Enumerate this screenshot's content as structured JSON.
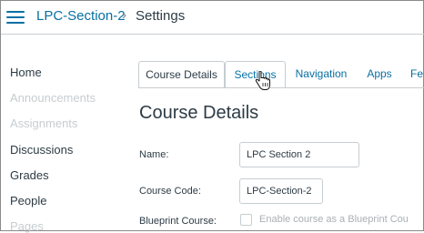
{
  "breadcrumb": {
    "course": "LPC-Section-2",
    "separator": "›",
    "current": "Settings"
  },
  "sidebar": {
    "items": [
      {
        "label": "Home",
        "enabled": true
      },
      {
        "label": "Announcements",
        "enabled": false
      },
      {
        "label": "Assignments",
        "enabled": false
      },
      {
        "label": "Discussions",
        "enabled": true
      },
      {
        "label": "Grades",
        "enabled": true
      },
      {
        "label": "People",
        "enabled": true
      },
      {
        "label": "Pages",
        "enabled": false
      }
    ]
  },
  "tabs": [
    {
      "label": "Course Details",
      "active": true
    },
    {
      "label": "Sections",
      "active": false
    },
    {
      "label": "Navigation",
      "active": false
    },
    {
      "label": "Apps",
      "active": false
    },
    {
      "label": "Fe",
      "active": false
    }
  ],
  "main": {
    "title": "Course Details",
    "name_label": "Name:",
    "name_value": "LPC Section 2",
    "code_label": "Course Code:",
    "code_value": "LPC-Section-2",
    "blueprint_label": "Blueprint Course:",
    "blueprint_checkbox_label": "Enable course as a Blueprint Cou",
    "blueprint_checked": false
  },
  "colors": {
    "link": "#0770a3",
    "text": "#2d3b45",
    "disabled": "#c7cdd1"
  }
}
